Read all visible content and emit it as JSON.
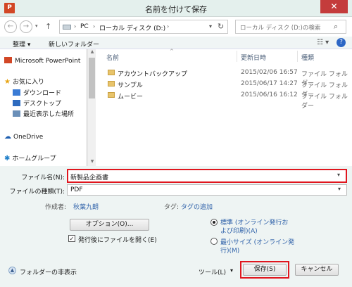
{
  "window": {
    "app_icon": "P",
    "title": "名前を付けて保存",
    "close": "✕"
  },
  "address": {
    "segments": [
      "PC",
      "ローカル ディスク (D:)"
    ]
  },
  "search": {
    "placeholder": "ローカル ディスク (D:)の検索"
  },
  "toolbar": {
    "organize": "整理 ▾",
    "new_folder": "新しいフォルダー"
  },
  "nav": {
    "items": [
      {
        "label": "Microsoft PowerPoint",
        "icon": "powerpoint-icon"
      },
      {
        "label": "お気に入り",
        "icon": "star-icon"
      },
      {
        "label": "ダウンロード",
        "icon": "download-icon"
      },
      {
        "label": "デスクトップ",
        "icon": "desktop-icon"
      },
      {
        "label": "最近表示した場所",
        "icon": "recent-icon"
      },
      {
        "label": "OneDrive",
        "icon": "cloud-icon"
      },
      {
        "label": "ホームグループ",
        "icon": "homegroup-icon"
      }
    ]
  },
  "files": {
    "columns": {
      "name": "名前",
      "modified": "更新日時",
      "type": "種類"
    },
    "rows": [
      {
        "name": "アカウントバックアップ",
        "modified": "2015/02/06 16:57",
        "type": "ファイル フォルダー"
      },
      {
        "name": "サンプル",
        "modified": "2015/06/17 14:27",
        "type": "ファイル フォルダー"
      },
      {
        "name": "ムービー",
        "modified": "2015/06/16 16:12",
        "type": "ファイル フォルダー"
      }
    ]
  },
  "form": {
    "filename_label": "ファイル名(N):",
    "filename_value": "新製品企画書",
    "filetype_label": "ファイルの種類(T):",
    "filetype_value": "PDF",
    "author_label": "作成者:",
    "author_value": "秋葉九朗",
    "tag_label": "タグ:",
    "tag_value": "タグの追加"
  },
  "options": {
    "options_button": "オプション(O)...",
    "open_after": "発行後にファイルを開く(E)",
    "open_after_checked": true,
    "radio_standard": "標準 (オンライン発行および印刷)(A)",
    "radio_standard_line1": "標準 (オンライン発行お",
    "radio_standard_line2": "よび印刷)(A)",
    "radio_min_line1": "最小サイズ (オンライン発",
    "radio_min_line2": "行)(M)"
  },
  "footer": {
    "hide_folders": "フォルダーの非表示",
    "tools": "ツール(L)",
    "save": "保存(S)",
    "cancel": "キャンセル"
  }
}
